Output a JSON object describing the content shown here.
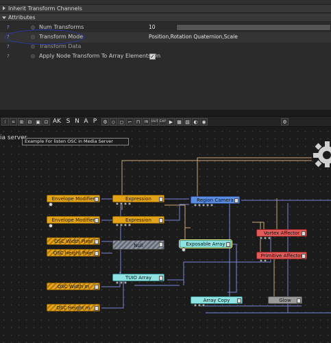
{
  "panel": {
    "inherit_section": "Inherit Transform Channels",
    "attributes_section": "Attributes",
    "rows": [
      {
        "label": "Num Transforms",
        "value": "10"
      },
      {
        "label": "Transform Mode",
        "value": "Position,Rotation Quaternion,Scale"
      },
      {
        "label": "Transform Data",
        "value": ""
      },
      {
        "label": "Apply Node Transform To Array Elements On",
        "value": "✓"
      }
    ],
    "help_glyph": "?"
  },
  "toolbar": {
    "buttons": [
      "⁝",
      "⌗",
      "⊞",
      "⊟",
      "▣",
      "⊡"
    ],
    "ak": "AK",
    "snap": [
      "S",
      "N",
      "A",
      "P"
    ],
    "tools": [
      "⚙",
      "◇",
      "◻",
      "⌐",
      "⊓",
      "IN",
      "OUT",
      "EXP",
      "▶",
      "▦",
      "▧",
      "◐",
      "◉"
    ],
    "settings_icon": "⚙"
  },
  "graph": {
    "title": "ia server",
    "comment": "Example For listen OSC in Media Server",
    "nodes": {
      "envelope1": "Envelope Modifier",
      "envelope2": "Envelope Modifier",
      "expression1": "Expression",
      "expression2": "Expression",
      "osc_width_pixel": "OSC Width Pixel",
      "osc_height_pixel": "OSC Height Pixel",
      "null": "Null",
      "tuio": "TUIO Array",
      "osc_width_m": "OSC Width m",
      "osc_height_m": "OSC Height m",
      "region_camera": "Region Camera",
      "exposable_array": "Exposable Array",
      "vortex": "Vortex Affector",
      "primitive": "Primitive Affector",
      "array_copy": "Array Copy",
      "glow": "Glow"
    }
  },
  "colors": {
    "orange": "#e2a319",
    "blue": "#5b8de0",
    "cyan": "#8fe2e2",
    "red": "#e05a5a",
    "highlight_oval": "#2a3bb0"
  }
}
